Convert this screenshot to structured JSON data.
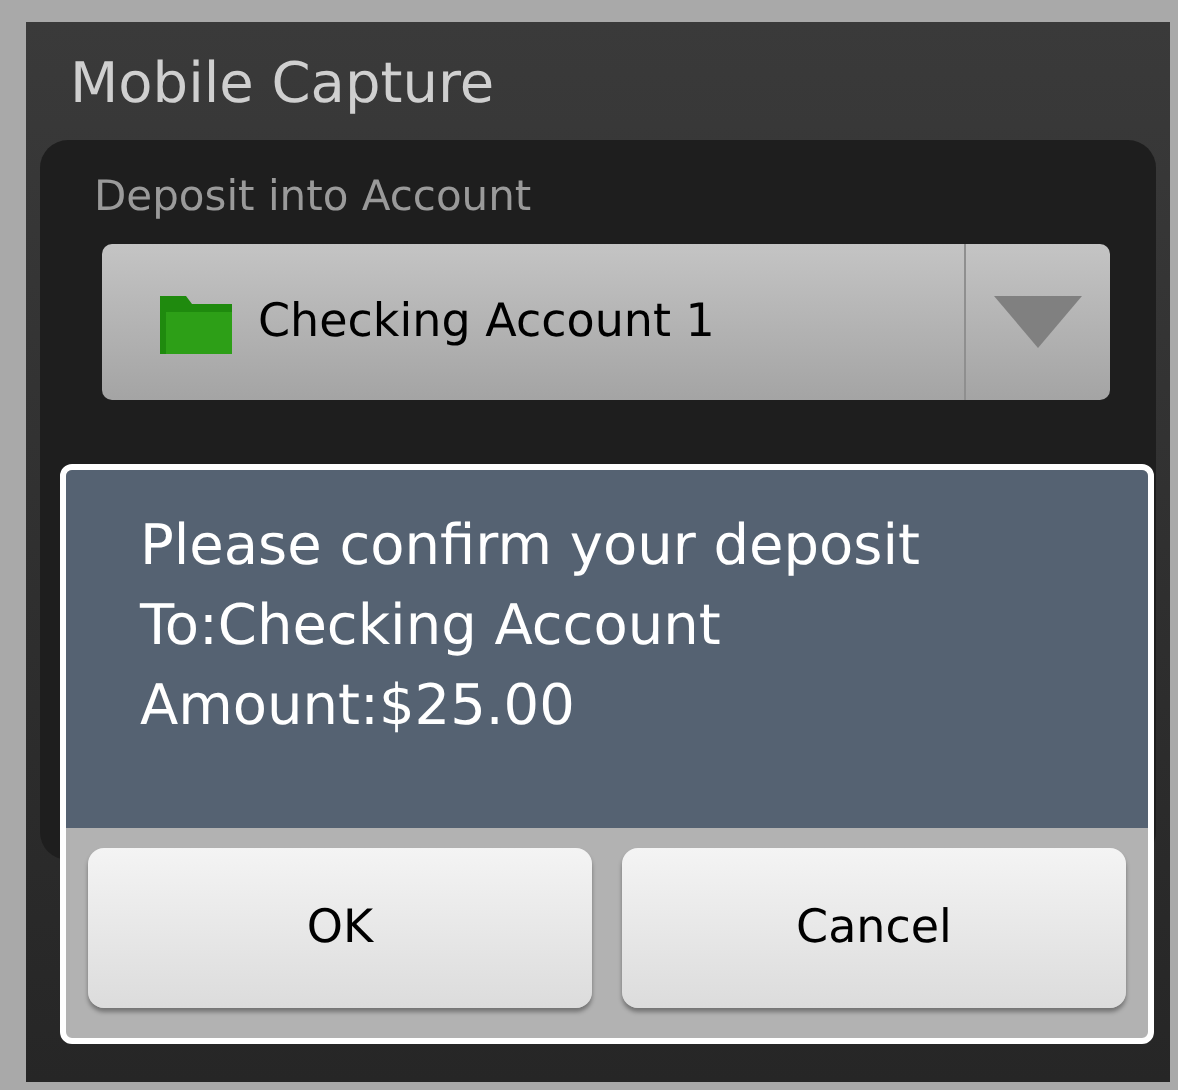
{
  "screen": {
    "title": "Mobile Capture"
  },
  "form": {
    "label": "Deposit into Account",
    "account_spinner": {
      "value": "Checking Account 1"
    }
  },
  "dialog": {
    "message_lines": [
      "Please confirm your deposit",
      "To:Checking Account",
      "Amount:$25.00"
    ],
    "buttons": [
      {
        "label": "OK"
      },
      {
        "label": "Cancel"
      }
    ]
  }
}
